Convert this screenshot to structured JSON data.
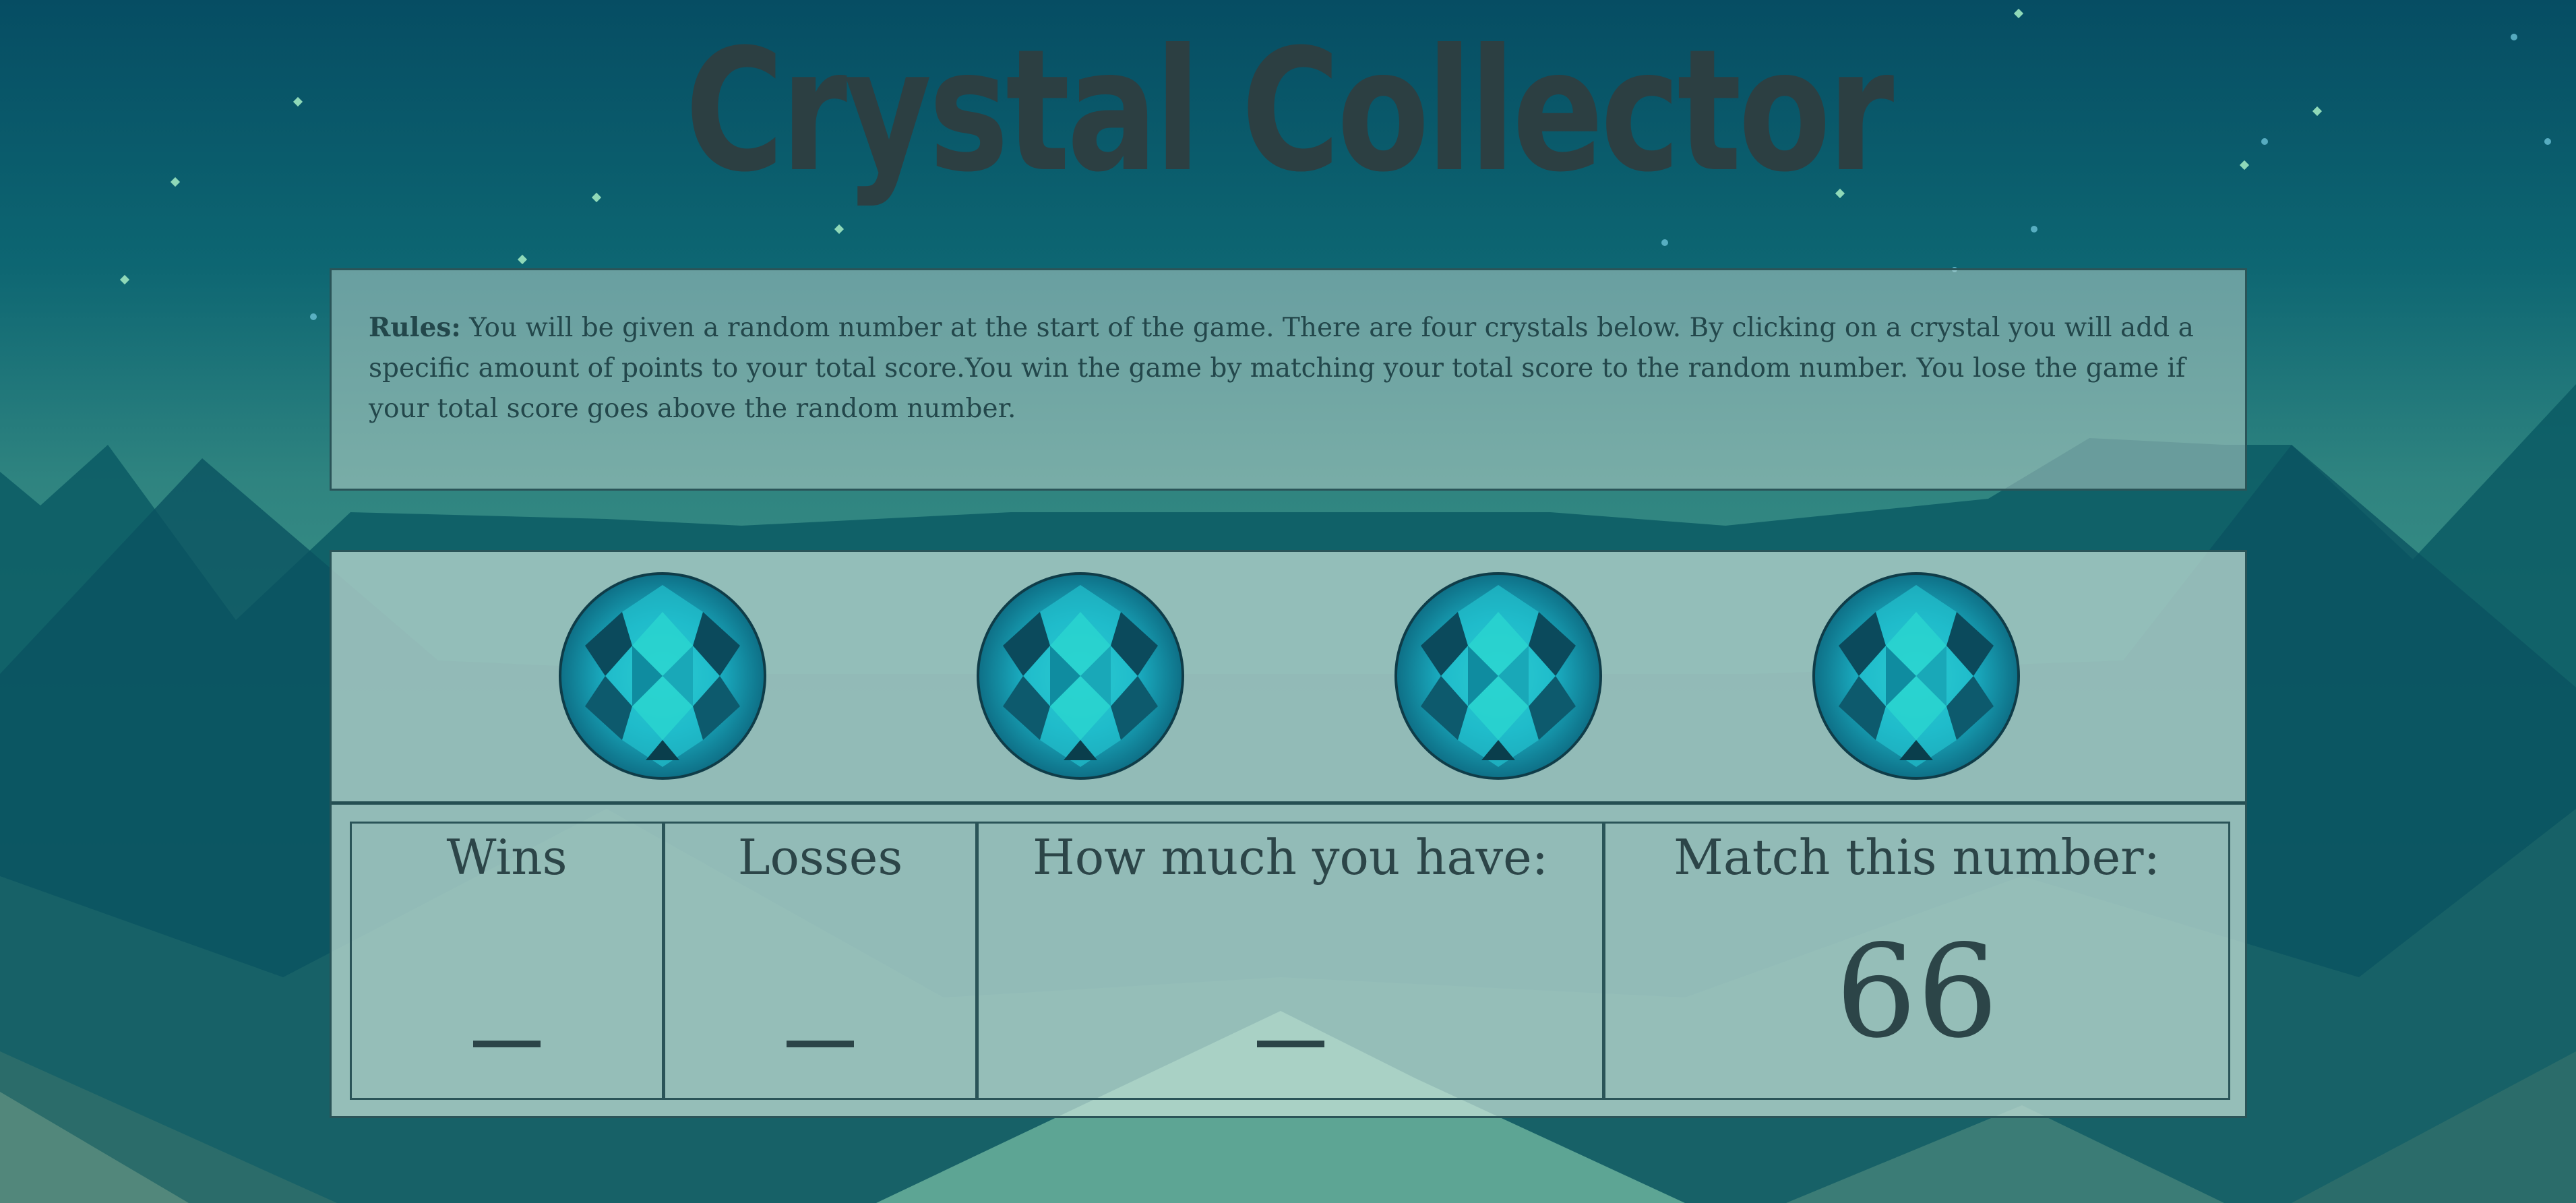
{
  "title": "Crystal Collector",
  "rules": {
    "label": "Rules:",
    "text": "You will be given a random number at the start of the game. There are four crystals below. By clicking on a crystal you will add a specific amount of points to your total score.You win the game by matching your total score to the random number. You lose the game if your total score goes above the random number."
  },
  "crystals": [
    {
      "name": "crystal-1"
    },
    {
      "name": "crystal-2"
    },
    {
      "name": "crystal-3"
    },
    {
      "name": "crystal-4"
    }
  ],
  "stats": {
    "wins_label": "Wins",
    "losses_label": "Losses",
    "have_label": "How much you have:",
    "match_label": "Match this number:",
    "match_value": "66"
  },
  "colors": {
    "title": "#2c3f42",
    "panel_border": "#2a5458",
    "crystal": "#1fb3c4"
  }
}
